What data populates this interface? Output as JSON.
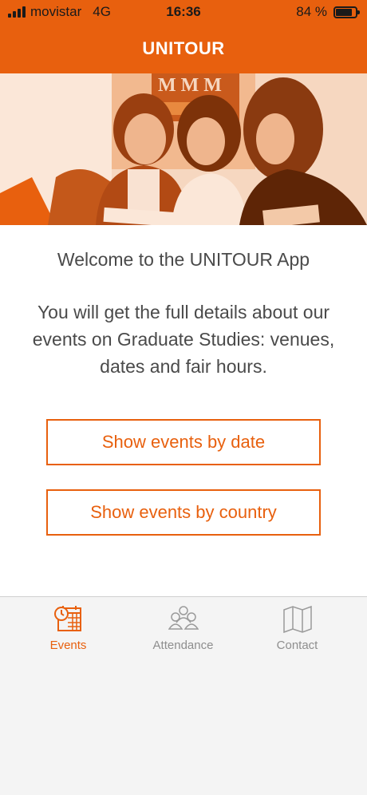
{
  "status_bar": {
    "carrier": "movistar",
    "network": "4G",
    "time": "16:36",
    "battery": "84 %",
    "battery_level": 0.84
  },
  "nav": {
    "title": "UNITOUR"
  },
  "main": {
    "welcome": "Welcome to the UNITOUR App",
    "description": "You will get the full details about our events on Graduate Studies: venues, dates and fair hours.",
    "btn_by_date": "Show events by date",
    "btn_by_country": "Show events by country"
  },
  "tabs": [
    {
      "label": "Events",
      "icon": "calendar-clock-icon",
      "active": true
    },
    {
      "label": "Attendance",
      "icon": "people-icon",
      "active": false
    },
    {
      "label": "Contact",
      "icon": "map-icon",
      "active": false
    }
  ],
  "colors": {
    "accent": "#e8600e",
    "inactive": "#8e8e8e"
  }
}
